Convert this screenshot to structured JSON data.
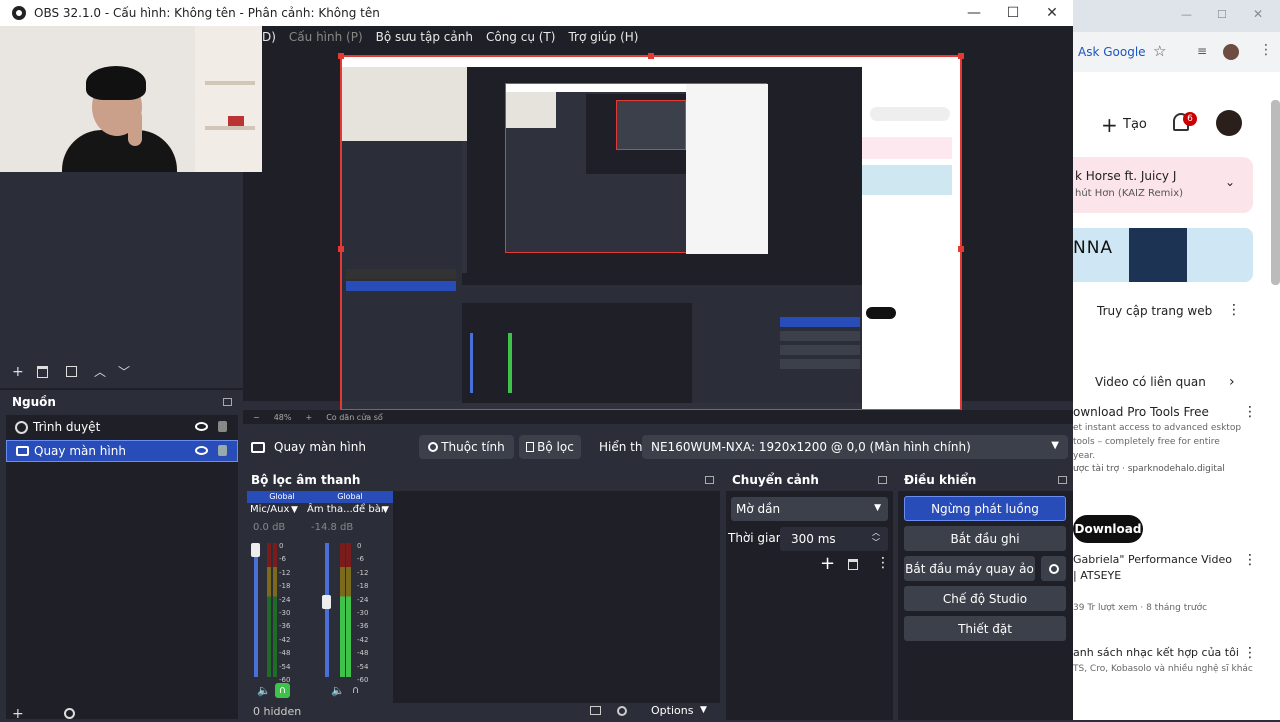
{
  "window": {
    "title": "OBS 32.1.0 - Cấu hình: Không tên - Phân cảnh: Không tên",
    "minimize": "—",
    "maximize": "☐",
    "close": "✕"
  },
  "menu": {
    "items": [
      "D)",
      "Cấu hình (P)",
      "Bộ sưu tập cảnh",
      "Công cụ (T)",
      "Trợ giúp (H)"
    ]
  },
  "scenes_toolbar": {
    "icons": [
      "plus-icon",
      "trash-icon",
      "filter-icon",
      "up-icon",
      "down-icon"
    ]
  },
  "sources": {
    "title": "Nguồn",
    "items": [
      {
        "label": "Trình duyệt",
        "icon": "globe-icon",
        "selected": false
      },
      {
        "label": "Quay màn hình",
        "icon": "monitor-icon",
        "selected": true
      }
    ]
  },
  "preview": {
    "zoom": "48%",
    "zoom_minus": "−",
    "zoom_plus": "+",
    "mode": "Co dãn cửa sổ"
  },
  "source_bar": {
    "source_name": "Quay màn hình",
    "properties_label": "Thuộc tính",
    "filters_label": "Bộ lọc",
    "display_label": "Hiển thị",
    "display_value": "NE160WUM-NXA: 1920x1200 @ 0,0 (Màn hình chính)"
  },
  "audio": {
    "title": "Bộ lọc âm thanh",
    "channels": [
      {
        "tag": "Global",
        "name": "Mic/Aux",
        "db": "0.0 dB",
        "level": 0
      },
      {
        "tag": "Global",
        "name": "Âm tha...để bàn",
        "db": "-14.8 dB",
        "level": 0.45
      }
    ],
    "ticks": [
      "0",
      "-6",
      "-12",
      "-18",
      "-24",
      "-30",
      "-36",
      "-42",
      "-48",
      "-54",
      "-60"
    ],
    "hidden_label": "0 hidden",
    "options_label": "Options"
  },
  "transitions": {
    "title": "Chuyển cảnh",
    "selected": "Mờ dần",
    "duration_label": "Thời gian",
    "duration_value": "300 ms"
  },
  "controls": {
    "title": "Điều khiển",
    "buttons": [
      "Ngừng phát luồng",
      "Bắt đầu ghi",
      "Bắt đầu máy quay ảo",
      "Chế độ Studio",
      "Thiết đặt"
    ]
  },
  "browser": {
    "ask_google": "Ask Google",
    "create_label": "Tạo",
    "notif_count": "6",
    "song_title": "k Horse ft. Juicy J",
    "song_sub": "hút Hơn (KAIZ Remix)",
    "ad_brand": "NNA",
    "visit_label": "Truy cập trang web",
    "related_label": "Video có liên quan",
    "ad_title": "ownload Pro Tools Free",
    "ad_desc": "et instant access to advanced esktop tools – completely free for entire year.",
    "ad_sponsor": "ược tài trợ · sparknodehalo.digital",
    "download_label": "Download",
    "v1_title": "Gabriela\" Performance Video | ATSEYE",
    "v1_meta": "39 Tr lượt xem · 8 tháng trước",
    "v2_title": "anh sách nhạc kết hợp của tôi",
    "v2_meta": "TS, Cro, Kobasolo và nhiều nghệ sĩ khác"
  },
  "colors": {
    "accent": "#284cb8",
    "bg": "#2b2e38",
    "dock": "#1f2027",
    "button": "#3c404b",
    "red": "#e53935"
  }
}
